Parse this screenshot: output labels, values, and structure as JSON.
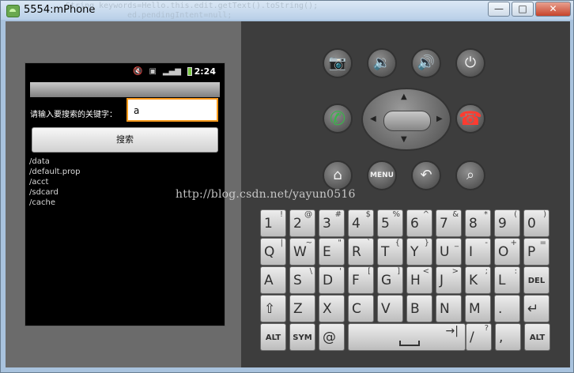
{
  "window": {
    "title": "5554:mPhone",
    "ghost_code_1": "String keywords=Hello.this.edit.getText().toString();",
    "ghost_code_2": "ed.pendingIntent=null;",
    "buttons": {
      "minimize": "—",
      "maximize": "□",
      "close": "✕"
    }
  },
  "status_bar": {
    "time": "2:24",
    "icons": [
      "volume-mute-icon",
      "sync-icon",
      "signal-icon",
      "battery-icon"
    ]
  },
  "app": {
    "prompt_label": "请输入要搜索的关键字：",
    "search_input_value": "a",
    "search_button_label": "搜索",
    "results": [
      "/data",
      "/default.prop",
      "/acct",
      "/sdcard",
      "/cache"
    ]
  },
  "controls": {
    "camera": "📷",
    "volume_down": "🔉",
    "volume_up": "🔊",
    "power": "⏻",
    "call": "✆",
    "end_call": "☎",
    "home": "⌂",
    "menu": "MENU",
    "back": "↶",
    "search": "⌕"
  },
  "keyboard": {
    "row1": [
      {
        "label": "1",
        "sup": "!"
      },
      {
        "label": "2",
        "sup": "@"
      },
      {
        "label": "3",
        "sup": "#"
      },
      {
        "label": "4",
        "sup": "$"
      },
      {
        "label": "5",
        "sup": "%"
      },
      {
        "label": "6",
        "sup": "^"
      },
      {
        "label": "7",
        "sup": "&"
      },
      {
        "label": "8",
        "sup": "*"
      },
      {
        "label": "9",
        "sup": "("
      },
      {
        "label": "0",
        "sup": ")"
      }
    ],
    "row2": [
      {
        "label": "Q",
        "sup": "|"
      },
      {
        "label": "W",
        "sup": "~"
      },
      {
        "label": "E",
        "sup": "\""
      },
      {
        "label": "R",
        "sup": "`"
      },
      {
        "label": "T",
        "sup": "{"
      },
      {
        "label": "Y",
        "sup": "}"
      },
      {
        "label": "U",
        "sup": "_"
      },
      {
        "label": "I",
        "sup": "-"
      },
      {
        "label": "O",
        "sup": "+"
      },
      {
        "label": "P",
        "sup": "="
      }
    ],
    "row3": [
      {
        "label": "A",
        "sup": ""
      },
      {
        "label": "S",
        "sup": "\\"
      },
      {
        "label": "D",
        "sup": "'"
      },
      {
        "label": "F",
        "sup": "["
      },
      {
        "label": "G",
        "sup": "]"
      },
      {
        "label": "H",
        "sup": "<"
      },
      {
        "label": "J",
        "sup": ">"
      },
      {
        "label": "K",
        "sup": ";"
      },
      {
        "label": "L",
        "sup": ":"
      },
      {
        "label": "DEL",
        "sup": ""
      }
    ],
    "row4": [
      {
        "label": "⇧",
        "sup": ""
      },
      {
        "label": "Z",
        "sup": ""
      },
      {
        "label": "X",
        "sup": ""
      },
      {
        "label": "C",
        "sup": ""
      },
      {
        "label": "V",
        "sup": ""
      },
      {
        "label": "B",
        "sup": ""
      },
      {
        "label": "N",
        "sup": ""
      },
      {
        "label": "M",
        "sup": ""
      },
      {
        "label": ".",
        "sup": ""
      },
      {
        "label": "↵",
        "sup": ""
      }
    ],
    "row5": {
      "alt_left": "ALT",
      "sym": "SYM",
      "at": "@",
      "space": "",
      "slash": "/",
      "slash_sup": "?",
      "comma": ",",
      "alt_right": "ALT"
    }
  },
  "watermark": "http://blog.csdn.net/yayun0516"
}
